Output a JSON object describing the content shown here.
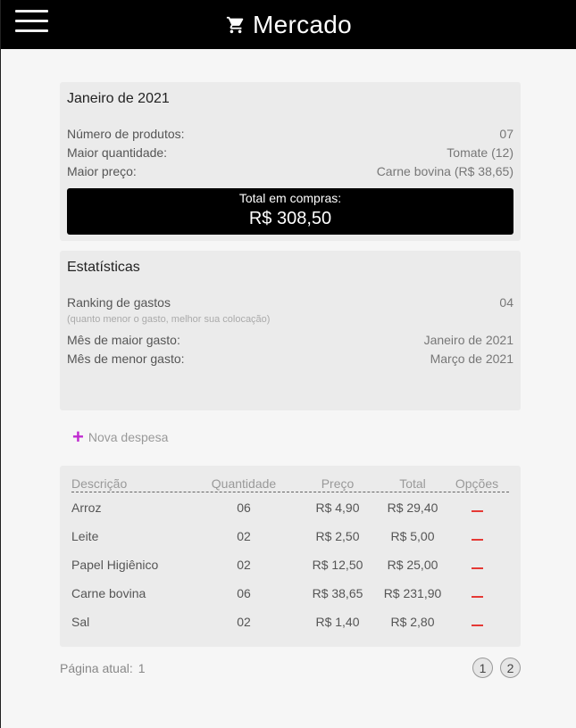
{
  "header": {
    "menu_icon": "hamburger-menu-icon",
    "cart_icon": "shopping-cart-icon",
    "title": "Mercado"
  },
  "summary": {
    "title": "Janeiro de 2021",
    "rows": [
      {
        "label": "Número de produtos:",
        "value": "07"
      },
      {
        "label": "Maior quantidade:",
        "value": "Tomate (12)"
      },
      {
        "label": "Maior preço:",
        "value": "Carne bovina (R$ 38,65)"
      }
    ],
    "total_label": "Total em compras:",
    "total_value": "R$ 308,50"
  },
  "stats": {
    "title": "Estatísticas",
    "ranking_label": "Ranking de gastos",
    "ranking_value": "04",
    "ranking_hint": "(quanto menor o gasto, melhor sua colocação)",
    "max_label": "Mês de maior gasto:",
    "max_value": "Janeiro de 2021",
    "min_label": "Mês de menor gasto:",
    "min_value": "Março de 2021"
  },
  "new_expense": {
    "icon": "plus-icon",
    "label": "Nova despesa",
    "color": "#c02ad0"
  },
  "table": {
    "headers": [
      "Descrição",
      "Quantidade",
      "Preço",
      "Total",
      "Opções"
    ],
    "rows": [
      {
        "desc": "Arroz",
        "qty": "06",
        "price": "R$ 4,90",
        "total": "R$ 29,40"
      },
      {
        "desc": "Leite",
        "qty": "02",
        "price": "R$ 2,50",
        "total": "R$ 5,00"
      },
      {
        "desc": "Papel Higiênico",
        "qty": "02",
        "price": "R$ 12,50",
        "total": "R$ 25,00"
      },
      {
        "desc": "Carne bovina",
        "qty": "06",
        "price": "R$ 38,65",
        "total": "R$ 231,90"
      },
      {
        "desc": "Sal",
        "qty": "02",
        "price": "R$ 1,40",
        "total": "R$ 2,80"
      }
    ],
    "remove_color": "#e53935"
  },
  "pagination": {
    "label": "Página atual:",
    "current": "1",
    "pages": [
      "1",
      "2"
    ]
  }
}
